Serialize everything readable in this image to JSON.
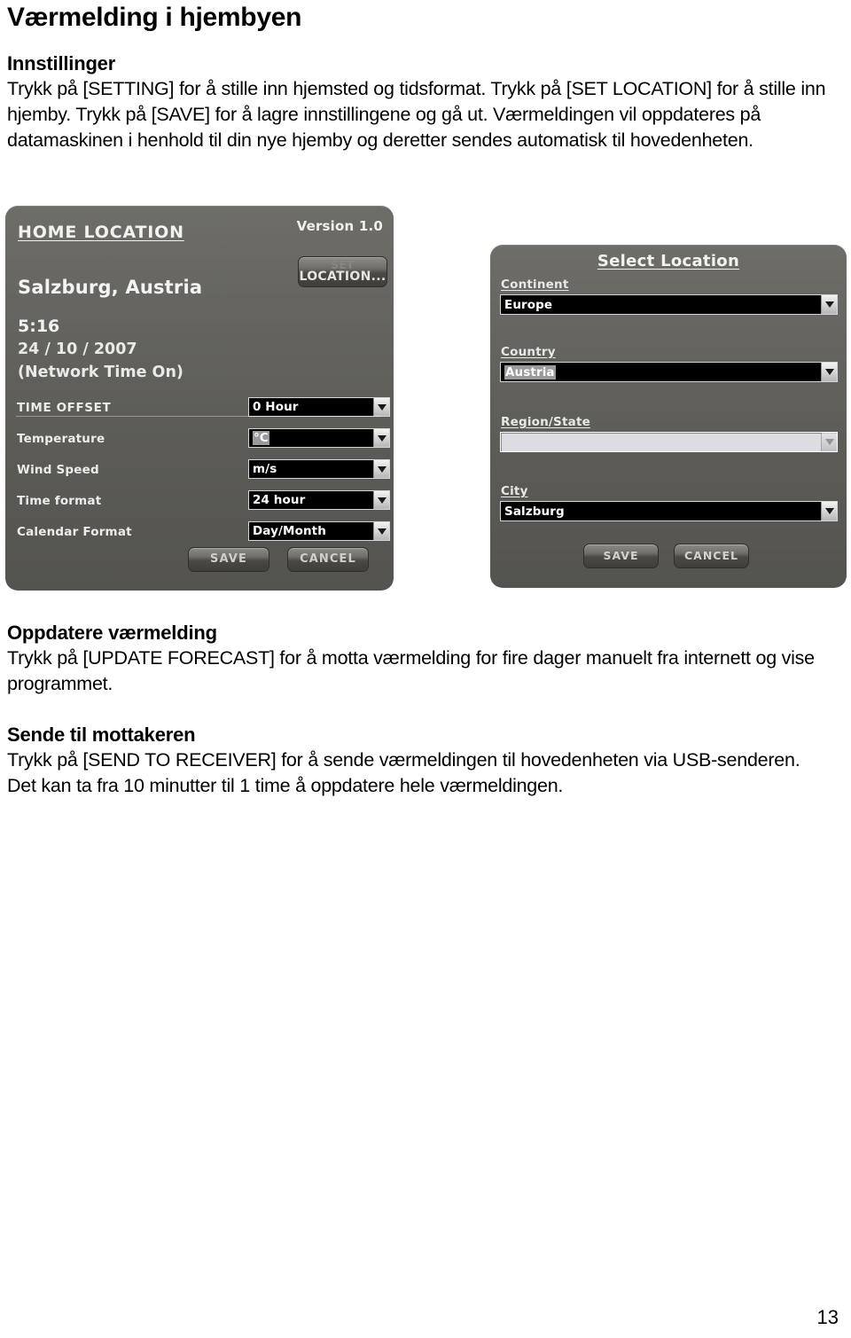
{
  "document": {
    "title": "Værmelding i hjembyen",
    "page_number": "13",
    "sections": [
      {
        "heading": "Innstillinger",
        "body": "Trykk på [SETTING] for å stille inn hjemsted og tidsformat. Trykk på [SET LOCATION] for å stille inn hjemby. Trykk på [SAVE] for å lagre innstillingene og gå ut. Værmeldingen vil oppdateres på datamaskinen i henhold til din nye hjemby og deretter sendes automatisk til hovedenheten."
      },
      {
        "heading": "Oppdatere værmelding",
        "body": "Trykk på [UPDATE FORECAST] for å motta værmelding for fire dager manuelt fra internett og vise programmet."
      },
      {
        "heading": "Sende til mottakeren",
        "body": "Trykk på [SEND TO RECEIVER] for å sende værmeldingen til hovedenheten via USB-senderen. Det kan ta fra 10 minutter til 1 time å oppdatere hele værmeldingen."
      }
    ]
  },
  "home_panel": {
    "title": "HOME LOCATION",
    "version": "Version 1.0",
    "set_location_button": {
      "line1": "SET",
      "line2": "LOCATION..."
    },
    "city": "Salzburg, Austria",
    "time": "5:16",
    "date": "24 / 10 / 2007",
    "network_status": "(Network Time On)",
    "settings": [
      {
        "label": "TIME OFFSET",
        "value": "0 Hour",
        "highlighted": false
      },
      {
        "label": "Temperature",
        "value": "°C",
        "highlighted": true
      },
      {
        "label": "Wind Speed",
        "value": "m/s",
        "highlighted": false
      },
      {
        "label": "Time format",
        "value": "24 hour",
        "highlighted": false
      },
      {
        "label": "Calendar Format",
        "value": "Day/Month",
        "highlighted": false
      }
    ],
    "save_label": "SAVE",
    "cancel_label": "CANCEL"
  },
  "select_panel": {
    "title": "Select Location",
    "fields": [
      {
        "label": "Continent",
        "value": "Europe",
        "highlighted": false,
        "disabled": false
      },
      {
        "label": "Country",
        "value": "Austria",
        "highlighted": true,
        "disabled": false
      },
      {
        "label": "Region/State",
        "value": "",
        "highlighted": false,
        "disabled": true
      },
      {
        "label": "City",
        "value": "Salzburg",
        "highlighted": false,
        "disabled": false
      }
    ],
    "save_label": "SAVE",
    "cancel_label": "CANCEL"
  },
  "colors": {
    "panel_top": "#6e6d68",
    "panel_bottom": "#545350",
    "dropdown_bg": "#000000",
    "dropdown_text": "#ffffff",
    "text_light": "#f2f2f0",
    "page_bg": "#ffffff",
    "page_text": "#000000"
  }
}
